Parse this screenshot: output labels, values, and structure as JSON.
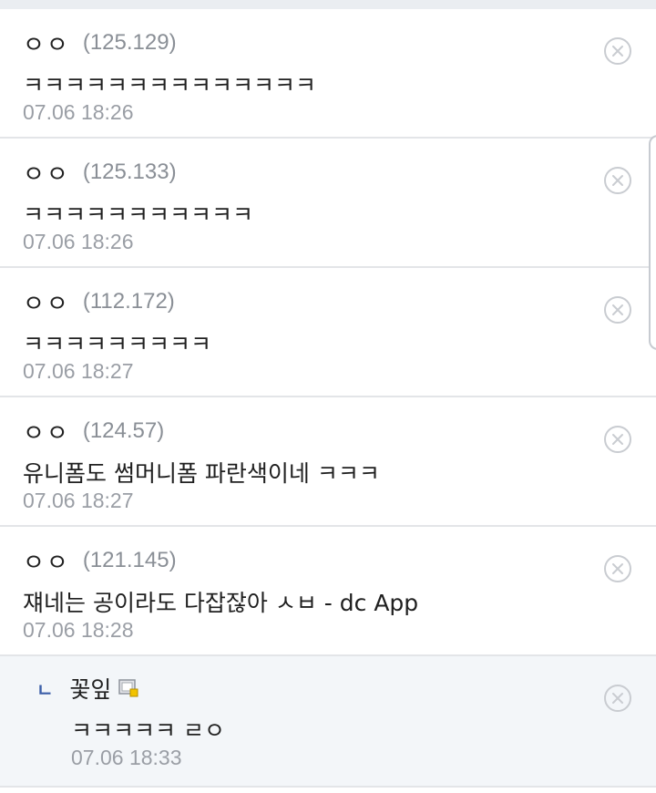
{
  "comments": [
    {
      "nick": "ㅇㅇ",
      "ip": "(125.129)",
      "text": "ㅋㅋㅋㅋㅋㅋㅋㅋㅋㅋㅋㅋㅋㅋ",
      "date": "07.06 18:26"
    },
    {
      "nick": "ㅇㅇ",
      "ip": "(125.133)",
      "text": "ㅋㅋㅋㅋㅋㅋㅋㅋㅋㅋㅋ",
      "date": "07.06 18:26"
    },
    {
      "nick": "ㅇㅇ",
      "ip": "(112.172)",
      "text": "ㅋㅋㅋㅋㅋㅋㅋㅋㅋ",
      "date": "07.06 18:27"
    },
    {
      "nick": "ㅇㅇ",
      "ip": "(124.57)",
      "text": "유니폼도 썸머니폼 파란색이네 ㅋㅋㅋ",
      "date": "07.06 18:27"
    },
    {
      "nick": "ㅇㅇ",
      "ip": "(121.145)",
      "text": "쟤네는 공이라도 다잡잖아 ㅅㅂ - dc App",
      "date": "07.06 18:28"
    }
  ],
  "reply": {
    "arrow": "ㄴ",
    "nick": "꽃잎",
    "text": "ㅋㅋㅋㅋㅋ ㄹㅇ",
    "date": "07.06 18:33"
  },
  "icons": {
    "delete": "close-circle-icon",
    "gallog": "gallog-icon"
  },
  "colors": {
    "ip": "#8a8f96",
    "date": "#9a9ea5",
    "reply_background": "#f3f6f9",
    "reply_arrow": "#3b5ea8"
  }
}
